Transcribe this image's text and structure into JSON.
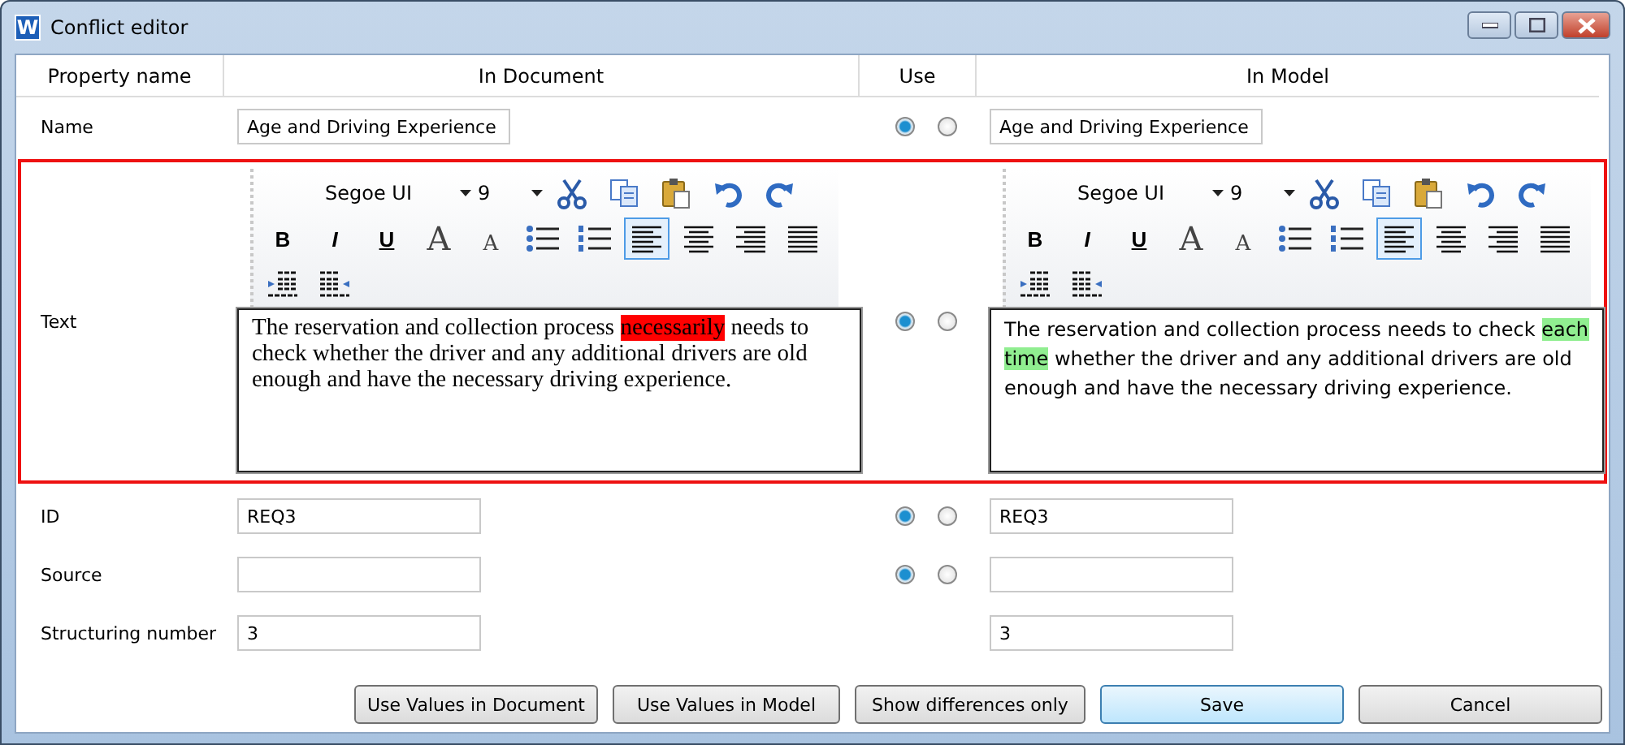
{
  "window": {
    "title": "Conflict editor",
    "icon_letter": "W"
  },
  "columns": [
    "Property name",
    "In Document",
    "Use",
    "In Model"
  ],
  "rows": [
    {
      "kind": "field",
      "label": "Name",
      "document": "Age and Driving Experience",
      "model": "Age and Driving Experience",
      "use": [
        {
          "selected": true
        },
        {
          "selected": false
        }
      ]
    },
    {
      "kind": "rich",
      "label": "Text",
      "conflict": true,
      "document": {
        "font": "Segoe UI",
        "size": "9",
        "format_buttons": [
          {
            "kind": "bold",
            "label": "B"
          },
          {
            "kind": "italic",
            "label": "I"
          },
          {
            "kind": "underline",
            "label": "U"
          },
          {
            "kind": "grow",
            "label": "A"
          },
          {
            "kind": "shrink",
            "label": "A"
          }
        ],
        "align_buttons": [
          {
            "kind": "left",
            "selected": true
          },
          {
            "kind": "center",
            "selected": false
          },
          {
            "kind": "right",
            "selected": false
          },
          {
            "kind": "justify",
            "selected": false
          }
        ],
        "segments": [
          {
            "text": "The reservation and collection process "
          },
          {
            "text": "necessarily",
            "color": "#ff0000"
          },
          {
            "text": " needs to check whether the driver and any additional drivers are old enough and have the necessary driving experience."
          }
        ]
      },
      "model": {
        "font": "Segoe UI",
        "size": "9",
        "format_buttons": [
          {
            "kind": "bold",
            "label": "B"
          },
          {
            "kind": "italic",
            "label": "I"
          },
          {
            "kind": "underline",
            "label": "U"
          },
          {
            "kind": "grow",
            "label": "A"
          },
          {
            "kind": "shrink",
            "label": "A"
          }
        ],
        "align_buttons": [
          {
            "kind": "left",
            "selected": true
          },
          {
            "kind": "center",
            "selected": false
          },
          {
            "kind": "right",
            "selected": false
          },
          {
            "kind": "justify",
            "selected": false
          }
        ],
        "segments": [
          {
            "text": "The reservation and collection process needs to check "
          },
          {
            "text": "each time",
            "color": "#90ee90"
          },
          {
            "text": " whether the driver and any additional drivers are old enough and have the necessary driving experience."
          }
        ]
      },
      "use": [
        {
          "selected": true
        },
        {
          "selected": false
        }
      ]
    },
    {
      "kind": "field",
      "label": "ID",
      "document": "REQ3",
      "model": "REQ3",
      "use": [
        {
          "selected": true
        },
        {
          "selected": false
        }
      ]
    },
    {
      "kind": "field",
      "label": "Source",
      "document": "",
      "model": "",
      "use": [
        {
          "selected": true
        },
        {
          "selected": false
        }
      ]
    },
    {
      "kind": "field",
      "label": "Structuring number",
      "document": "3",
      "model": "3"
    }
  ],
  "buttons": [
    {
      "label": "Use Values in Document",
      "default": false
    },
    {
      "label": "Use Values in Model",
      "default": false
    },
    {
      "label": "Show differences only",
      "default": false
    },
    {
      "label": "Save",
      "default": true
    },
    {
      "label": "Cancel",
      "default": false
    }
  ]
}
